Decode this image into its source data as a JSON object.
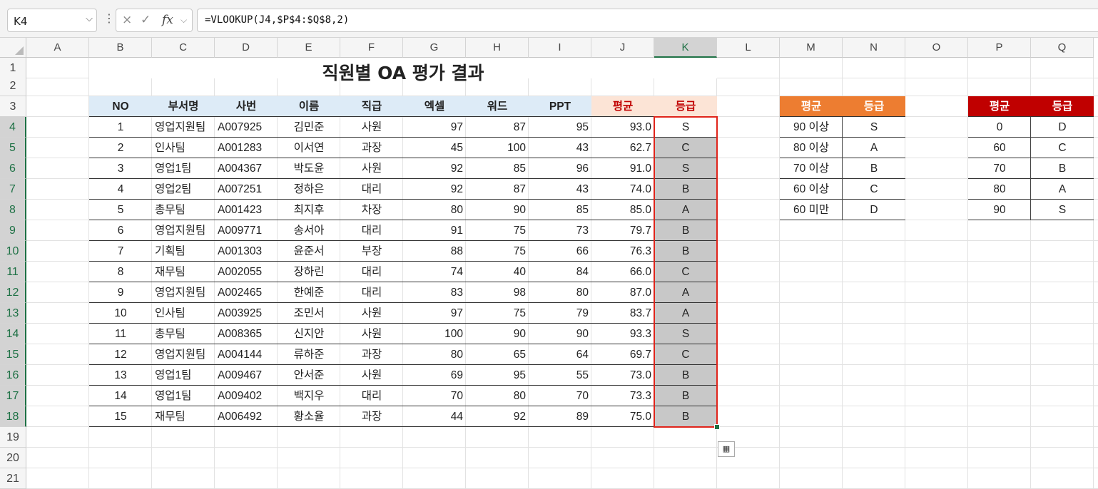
{
  "formula_bar": {
    "name_box": "K4",
    "formula": "=VLOOKUP(J4,$P$4:$Q$8,2)",
    "cancel_icon": "×",
    "enter_icon": "✓",
    "fx_label": "fx"
  },
  "columns": [
    "A",
    "B",
    "C",
    "D",
    "E",
    "F",
    "G",
    "H",
    "I",
    "J",
    "K",
    "L",
    "M",
    "N",
    "O",
    "P",
    "Q"
  ],
  "rows": [
    "1",
    "2",
    "3",
    "4",
    "5",
    "6",
    "7",
    "8",
    "9",
    "10",
    "11",
    "12",
    "13",
    "14",
    "15",
    "16",
    "17",
    "18",
    "19",
    "20",
    "21"
  ],
  "title": "직원별 OA 평가 결과",
  "table": {
    "headers": [
      "NO",
      "부서명",
      "사번",
      "이름",
      "직급",
      "엑셀",
      "워드",
      "PPT",
      "평균",
      "등급"
    ],
    "rows": [
      [
        "1",
        "영업지원팀",
        "A007925",
        "김민준",
        "사원",
        "97",
        "87",
        "95",
        "93.0",
        "S"
      ],
      [
        "2",
        "인사팀",
        "A001283",
        "이서연",
        "과장",
        "45",
        "100",
        "43",
        "62.7",
        "C"
      ],
      [
        "3",
        "영업1팀",
        "A004367",
        "박도윤",
        "사원",
        "92",
        "85",
        "96",
        "91.0",
        "S"
      ],
      [
        "4",
        "영업2팀",
        "A007251",
        "정하은",
        "대리",
        "92",
        "87",
        "43",
        "74.0",
        "B"
      ],
      [
        "5",
        "총무팀",
        "A001423",
        "최지후",
        "차장",
        "80",
        "90",
        "85",
        "85.0",
        "A"
      ],
      [
        "6",
        "영업지원팀",
        "A009771",
        "송서아",
        "대리",
        "91",
        "75",
        "73",
        "79.7",
        "B"
      ],
      [
        "7",
        "기획팀",
        "A001303",
        "윤준서",
        "부장",
        "88",
        "75",
        "66",
        "76.3",
        "B"
      ],
      [
        "8",
        "재무팀",
        "A002055",
        "장하린",
        "대리",
        "74",
        "40",
        "84",
        "66.0",
        "C"
      ],
      [
        "9",
        "영업지원팀",
        "A002465",
        "한예준",
        "대리",
        "83",
        "98",
        "80",
        "87.0",
        "A"
      ],
      [
        "10",
        "인사팀",
        "A003925",
        "조민서",
        "사원",
        "97",
        "75",
        "79",
        "83.7",
        "A"
      ],
      [
        "11",
        "총무팀",
        "A008365",
        "신지안",
        "사원",
        "100",
        "90",
        "90",
        "93.3",
        "S"
      ],
      [
        "12",
        "영업지원팀",
        "A004144",
        "류하준",
        "과장",
        "80",
        "65",
        "64",
        "69.7",
        "C"
      ],
      [
        "13",
        "영업1팀",
        "A009467",
        "안서준",
        "사원",
        "69",
        "95",
        "55",
        "73.0",
        "B"
      ],
      [
        "14",
        "영업1팀",
        "A009402",
        "백지우",
        "대리",
        "70",
        "80",
        "70",
        "73.3",
        "B"
      ],
      [
        "15",
        "재무팀",
        "A006492",
        "황소율",
        "과장",
        "44",
        "92",
        "89",
        "75.0",
        "B"
      ]
    ]
  },
  "grade_table_1": {
    "headers": [
      "평균",
      "등급"
    ],
    "rows": [
      [
        "90 이상",
        "S"
      ],
      [
        "80 이상",
        "A"
      ],
      [
        "70 이상",
        "B"
      ],
      [
        "60 이상",
        "C"
      ],
      [
        "60 미만",
        "D"
      ]
    ]
  },
  "grade_table_2": {
    "headers": [
      "평균",
      "등급"
    ],
    "rows": [
      [
        "0",
        "D"
      ],
      [
        "60",
        "C"
      ],
      [
        "70",
        "B"
      ],
      [
        "80",
        "A"
      ],
      [
        "90",
        "S"
      ]
    ]
  },
  "colors": {
    "header_blue": "#ddebf7",
    "header_peach": "#fce4d6",
    "orange": "#ed7d31",
    "red": "#c00000",
    "selection_red": "#e0241b",
    "selected_fill": "#c8c8c8"
  }
}
